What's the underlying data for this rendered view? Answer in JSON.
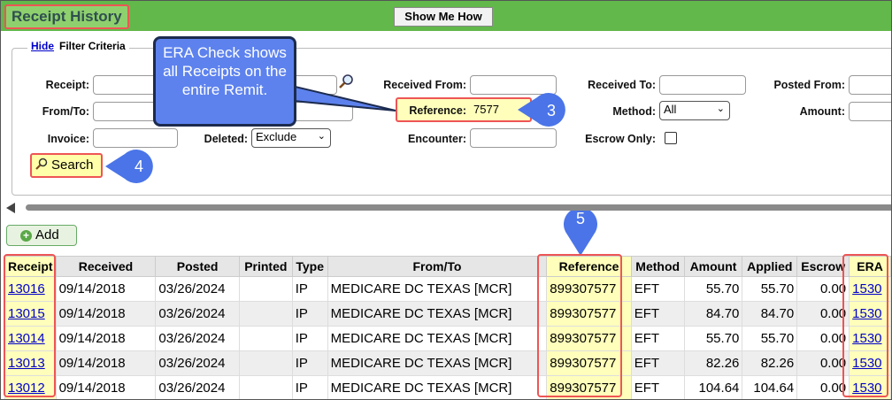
{
  "header": {
    "title": "Receipt History",
    "show_me_label": "Show Me How"
  },
  "filter": {
    "hide_link": "Hide",
    "title": "Filter Criteria",
    "fields": {
      "receipt": "Receipt:",
      "from_to": "From/To:",
      "invoice": "Invoice:",
      "deleted": "Deleted:",
      "deleted_value": "Exclude",
      "received_from": "Received From:",
      "reference": "Reference:",
      "reference_value": "7577",
      "encounter": "Encounter:",
      "received_to": "Received To:",
      "method": "Method:",
      "method_value": "All",
      "escrow_only": "Escrow Only:",
      "posted_from": "Posted From:",
      "amount": "Amount:"
    },
    "search_label": "Search"
  },
  "callout": {
    "text": "ERA Check shows all Receipts on the entire Remit."
  },
  "badges": {
    "b3": "3",
    "b4": "4",
    "b5": "5"
  },
  "add_label": "Add",
  "table": {
    "headers": [
      "Receipt",
      "Received",
      "Posted",
      "Printed",
      "Type",
      "From/To",
      "Reference",
      "Method",
      "Amount",
      "Applied",
      "Escrow",
      "ERA"
    ],
    "rows": [
      [
        "13016",
        "09/14/2018",
        "03/26/2024",
        "",
        "IP",
        "MEDICARE DC TEXAS [MCR]",
        "899307577",
        "EFT",
        "55.70",
        "55.70",
        "0.00",
        "1530"
      ],
      [
        "13015",
        "09/14/2018",
        "03/26/2024",
        "",
        "IP",
        "MEDICARE DC TEXAS [MCR]",
        "899307577",
        "EFT",
        "84.70",
        "84.70",
        "0.00",
        "1530"
      ],
      [
        "13014",
        "09/14/2018",
        "03/26/2024",
        "",
        "IP",
        "MEDICARE DC TEXAS [MCR]",
        "899307577",
        "EFT",
        "55.70",
        "55.70",
        "0.00",
        "1530"
      ],
      [
        "13013",
        "09/14/2018",
        "03/26/2024",
        "",
        "IP",
        "MEDICARE DC TEXAS [MCR]",
        "899307577",
        "EFT",
        "82.26",
        "82.26",
        "0.00",
        "1530"
      ],
      [
        "13012",
        "09/14/2018",
        "03/26/2024",
        "",
        "IP",
        "MEDICARE DC TEXAS [MCR]",
        "899307577",
        "EFT",
        "104.64",
        "104.64",
        "0.00",
        "1530"
      ]
    ]
  },
  "colors": {
    "header_green": "#62b84a",
    "highlight_yellow": "#ffffbb",
    "annotation_red": "#e55555",
    "callout_blue": "#5d82ee"
  }
}
